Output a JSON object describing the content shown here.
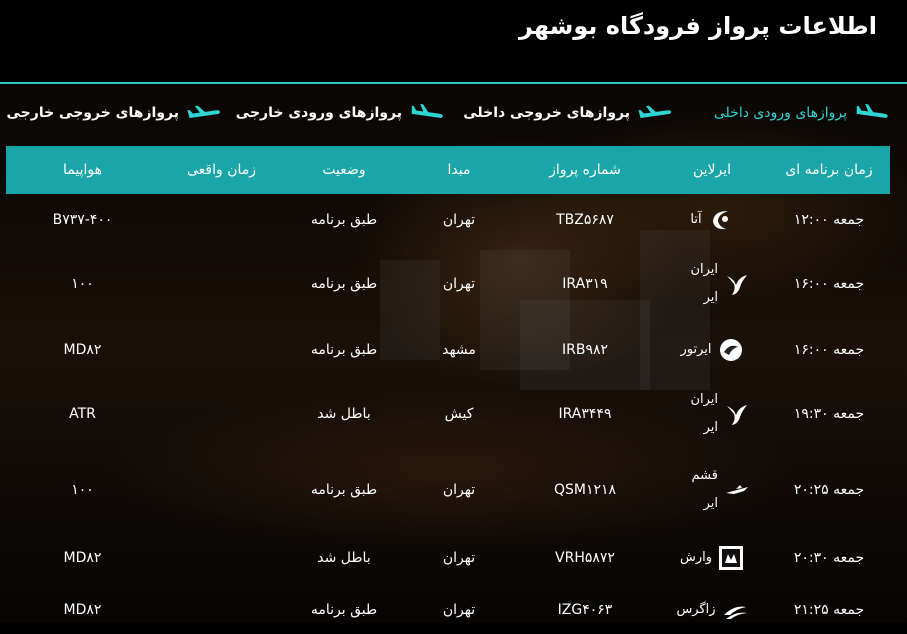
{
  "page_title": "اطلاعات پرواز فرودگاه بوشهر",
  "tabs": [
    {
      "label": "پروازهای ورودی داخلی",
      "active": true
    },
    {
      "label": "پروازهای خروجی داخلی",
      "active": false
    },
    {
      "label": "پروازهای ورودی خارجی",
      "active": false
    },
    {
      "label": "پروازهای خروجی خارجی",
      "active": false
    }
  ],
  "table": {
    "headers": [
      "زمان برنامه ای",
      "ایرلاین",
      "شماره پرواز",
      "مبدا",
      "وضعیت",
      "زمان واقعی",
      "هواپیما"
    ],
    "rows": [
      {
        "scheduled": "جمعه ۱۲:۰۰",
        "airline": "آتا",
        "airline_icon": "ata-logo-icon",
        "flight": "TBZ۵۶۸۷",
        "origin": "تهران",
        "status": "طبق برنامه",
        "actual": "",
        "aircraft": "B۷۳۷-۴۰۰"
      },
      {
        "scheduled": "جمعه ۱۶:۰۰",
        "airline": "ایران ایر",
        "airline_icon": "iranair-logo-icon",
        "flight": "IRA۳۱۹",
        "origin": "تهران",
        "status": "طبق برنامه",
        "actual": "",
        "aircraft": "۱۰۰"
      },
      {
        "scheduled": "جمعه ۱۶:۰۰",
        "airline": "ایرتور",
        "airline_icon": "iranairtour-logo-icon",
        "flight": "IRB۹۸۲",
        "origin": "مشهد",
        "status": "طبق برنامه",
        "actual": "",
        "aircraft": "MD۸۲"
      },
      {
        "scheduled": "جمعه ۱۹:۳۰",
        "airline": "ایران ایر",
        "airline_icon": "iranair-logo-icon",
        "flight": "IRA۳۴۴۹",
        "origin": "کیش",
        "status": "باطل شد",
        "actual": "",
        "aircraft": "ATR"
      },
      {
        "scheduled": "جمعه ۲۰:۲۵",
        "airline": "قشم ایر",
        "airline_icon": "qeshmair-logo-icon",
        "flight": "QSM۱۲۱۸",
        "origin": "تهران",
        "status": "طبق برنامه",
        "actual": "",
        "aircraft": "۱۰۰"
      },
      {
        "scheduled": "جمعه ۲۰:۳۰",
        "airline": "وارش",
        "airline_icon": "varesh-logo-icon",
        "flight": "VRH۵۸۷۲",
        "origin": "تهران",
        "status": "باطل شد",
        "actual": "",
        "aircraft": "MD۸۲"
      },
      {
        "scheduled": "جمعه ۲۱:۲۵",
        "airline": "زاگرس",
        "airline_icon": "zagros-logo-icon",
        "flight": "IZG۴۰۶۳",
        "origin": "تهران",
        "status": "طبق برنامه",
        "actual": "",
        "aircraft": "MD۸۲"
      }
    ]
  },
  "colors": {
    "accent": "#2fc6c6",
    "header_bg": "#1aa6a8",
    "active_tab": "#2fd4d4"
  }
}
